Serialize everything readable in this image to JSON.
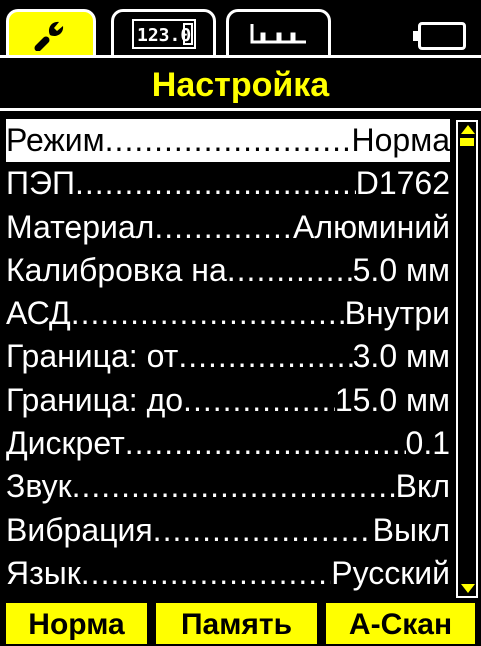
{
  "tabs": [
    {
      "icon": "wrench-icon",
      "active": true
    },
    {
      "icon": "numeric-display-icon",
      "active": false
    },
    {
      "icon": "waveform-icon",
      "active": false
    }
  ],
  "status": {
    "battery_icon": "battery-icon"
  },
  "title": "Настройка",
  "settings": [
    {
      "label": "Режим",
      "value": "Норма"
    },
    {
      "label": "ПЭП",
      "value": "D1762"
    },
    {
      "label": "Материал",
      "value": "Алюминий"
    },
    {
      "label": "Калибровка на",
      "value": "5.0 мм"
    },
    {
      "label": "АСД",
      "value": "Внутри"
    },
    {
      "label": "Граница: от",
      "value": "3.0 мм"
    },
    {
      "label": "Граница: до",
      "value": "15.0 мм"
    },
    {
      "label": "Дискрет",
      "value": "0.1"
    },
    {
      "label": "Звук",
      "value": "Вкл"
    },
    {
      "label": "Вибрация",
      "value": "Выкл"
    },
    {
      "label": "Язык",
      "value": "Русский"
    }
  ],
  "softkeys": {
    "left": "Норма",
    "middle": "Память",
    "right": "А-Скан"
  },
  "colors": {
    "accent": "#ffff00",
    "background": "#000000",
    "text": "#ffffff"
  }
}
